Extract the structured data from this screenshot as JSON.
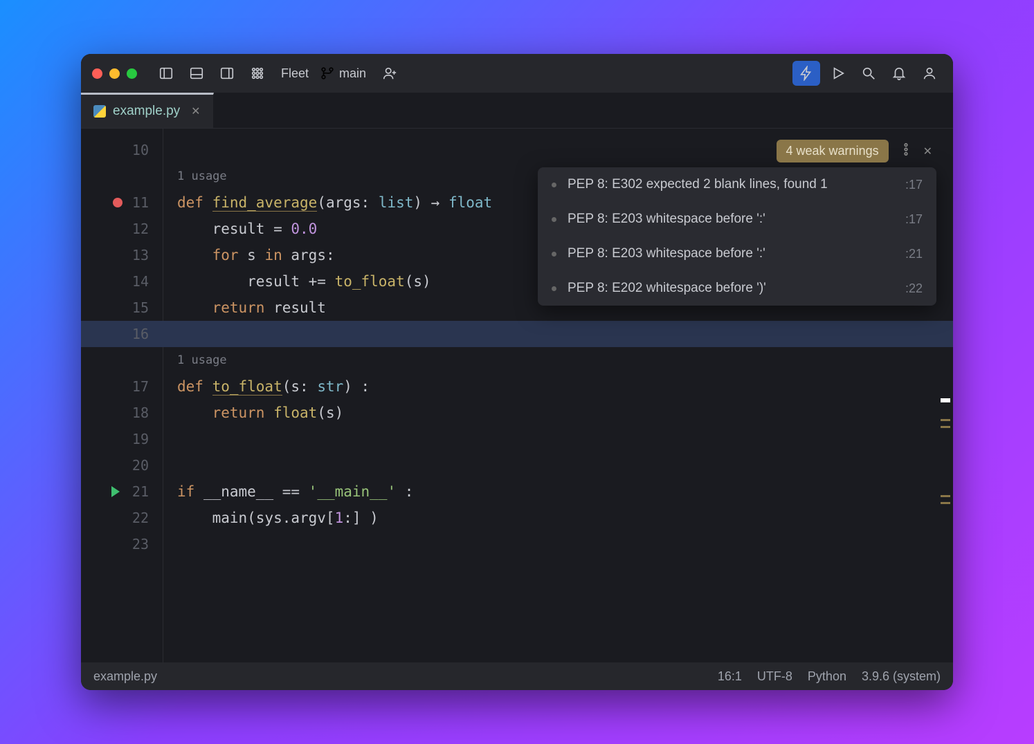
{
  "titlebar": {
    "app_name": "Fleet",
    "branch": "main"
  },
  "tab": {
    "filename": "example.py"
  },
  "gutter_lines": [
    "10",
    "",
    "11",
    "12",
    "13",
    "14",
    "15",
    "16",
    "",
    "17",
    "18",
    "19",
    "20",
    "21",
    "22",
    "23"
  ],
  "usage_hint": "1 usage",
  "code": {
    "l11": {
      "def": "def ",
      "fn": "find_average",
      "args": "(args: ",
      "typ": "list",
      "rest": ") → ",
      "ret": "float"
    },
    "l12": {
      "pre": "    result = ",
      "num": "0.0"
    },
    "l13": {
      "for": "    for ",
      "s": "s ",
      "in": "in ",
      "args": "args:"
    },
    "l14": {
      "pre": "        result += ",
      "fn": "to_float",
      "rest": "(s)"
    },
    "l15": {
      "ret": "    return ",
      "val": "result"
    },
    "l17": {
      "def": "def ",
      "fn": "to_float",
      "args": "(s: ",
      "typ": "str",
      "rest": ") :"
    },
    "l18": {
      "ret": "    return ",
      "fn": "float",
      "rest": "(s)"
    },
    "l21": {
      "if": "if ",
      "name": "__name__",
      "eq": " == ",
      "str": "'__main__'",
      "rest": " :"
    },
    "l22": {
      "pre": "    main(sys.argv[",
      "num": "1",
      "rest": ":] )"
    }
  },
  "problems": {
    "badge": "4 weak warnings",
    "items": [
      {
        "msg": "PEP 8: E302 expected 2 blank lines, found 1",
        "loc": ":17"
      },
      {
        "msg": "PEP 8: E203 whitespace before ':'",
        "loc": ":17"
      },
      {
        "msg": "PEP 8: E203 whitespace before ':'",
        "loc": ":21"
      },
      {
        "msg": "PEP 8: E202 whitespace before ')'",
        "loc": ":22"
      }
    ]
  },
  "status": {
    "filepath": "example.py",
    "cursor": "16:1",
    "encoding": "UTF-8",
    "language": "Python",
    "interpreter": "3.9.6 (system)"
  }
}
